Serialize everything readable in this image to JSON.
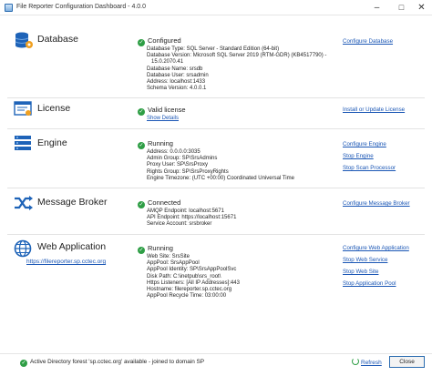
{
  "window": {
    "title": "File Reporter Configuration Dashboard - 4.0.0"
  },
  "sections": {
    "database": {
      "title": "Database",
      "status": "Configured",
      "details": [
        "Database Type: SQL Server - Standard Edition (64-bit)",
        "Database Version: Microsoft SQL Server 2019 (RTM-GDR) (KB4517790) -",
        "15.0.2070.41",
        "Database Name: srsdb",
        "Database User: srsadmin",
        "Address: localhost:1433",
        "Schema Version: 4.0.0.1"
      ],
      "actions": [
        "Configure Database"
      ]
    },
    "license": {
      "title": "License",
      "status": "Valid license",
      "sublink": "Show Details",
      "actions": [
        "Install or Update License"
      ]
    },
    "engine": {
      "title": "Engine",
      "status": "Running",
      "details": [
        "Address: 0.0.0.0:3035",
        "Admin Group: SP\\SrsAdmins",
        "Proxy User: SP\\SrsProxy",
        "Rights Group: SP\\SrsProxyRights",
        "Engine Timezone: (UTC +00:00)  Coordinated Universal Time"
      ],
      "actions": [
        "Configure Engine",
        "Stop Engine",
        "Stop Scan Processor"
      ]
    },
    "message_broker": {
      "title": "Message Broker",
      "status": "Connected",
      "details": [
        "AMQP Endpoint: localhost:5671",
        "API Endpoint:  https://localhost:15671",
        "Service Account: srsbroker"
      ],
      "actions": [
        "Configure Message Broker"
      ]
    },
    "web_application": {
      "title": "Web Application",
      "link": "https://filereporter.sp.cctec.org",
      "status": "Running",
      "details": [
        "Web Site: SrsSite",
        "AppPool: SrsAppPool",
        "AppPool Identity: SP\\SrsAppPoolSvc",
        "Disk Path: C:\\inetpub\\srs_root\\",
        "Https Listeners: [All IP Addresses]:443",
        "Hostname: filereporter.sp.cctec.org",
        "AppPool Recycle Time: 03:00:00"
      ],
      "actions": [
        "Configure Web Application",
        "Stop Web Service",
        "Stop Web Site",
        "Stop Application Pool"
      ]
    }
  },
  "footer": {
    "status": "Active Directory forest 'sp.cctec.org' available - joined to domain SP",
    "refresh_label": "Refresh",
    "close_label": "Close"
  },
  "colors": {
    "link": "#1a56b5",
    "ok": "#2e9e45"
  }
}
